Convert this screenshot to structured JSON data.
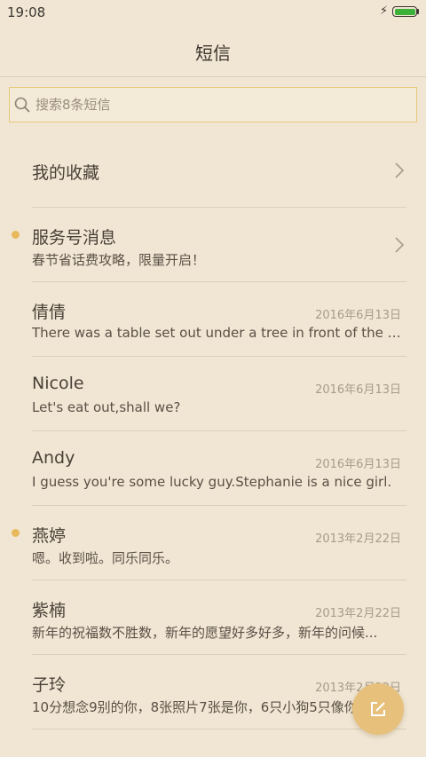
{
  "status_bar": {
    "time": "19:08",
    "battery_color": "#3bb13a"
  },
  "header": {
    "title": "短信"
  },
  "search": {
    "placeholder": "搜索8条短信"
  },
  "favorites": {
    "label": "我的收藏"
  },
  "service": {
    "name": "服务号消息",
    "snippet": "春节省话费攻略，限量开启！",
    "unread": true
  },
  "conversations": [
    {
      "name": "倩倩",
      "date": "2016年6月13日",
      "snippet": "There was a table set out under a tree in front of the ho...",
      "unread": false
    },
    {
      "name": "Nicole",
      "date": "2016年6月13日",
      "snippet": "Let's eat out,shall we?",
      "unread": false
    },
    {
      "name": "Andy",
      "date": "2016年6月13日",
      "snippet": "I guess you're some lucky guy.Stephanie is a nice girl.",
      "unread": false
    },
    {
      "name": "燕婷",
      "date": "2013年2月22日",
      "snippet": "嗯。收到啦。同乐同乐。",
      "unread": true
    },
    {
      "name": "紫楠",
      "date": "2013年2月22日",
      "snippet": "新年的祝福数不胜数，新年的愿望好多好多，新年的问候...",
      "unread": false
    },
    {
      "name": "子玲",
      "date": "2013年2月22日",
      "snippet": "10分想念9别的你，8张照片7张是你，6只小狗5只像你",
      "unread": false
    }
  ],
  "colors": {
    "background": "#f1e6d4",
    "accent": "#e7c17b",
    "unread_dot": "#e7b95c"
  },
  "icons": {
    "search": "search-icon",
    "chevron": "chevron-right-icon",
    "compose": "compose-icon"
  }
}
